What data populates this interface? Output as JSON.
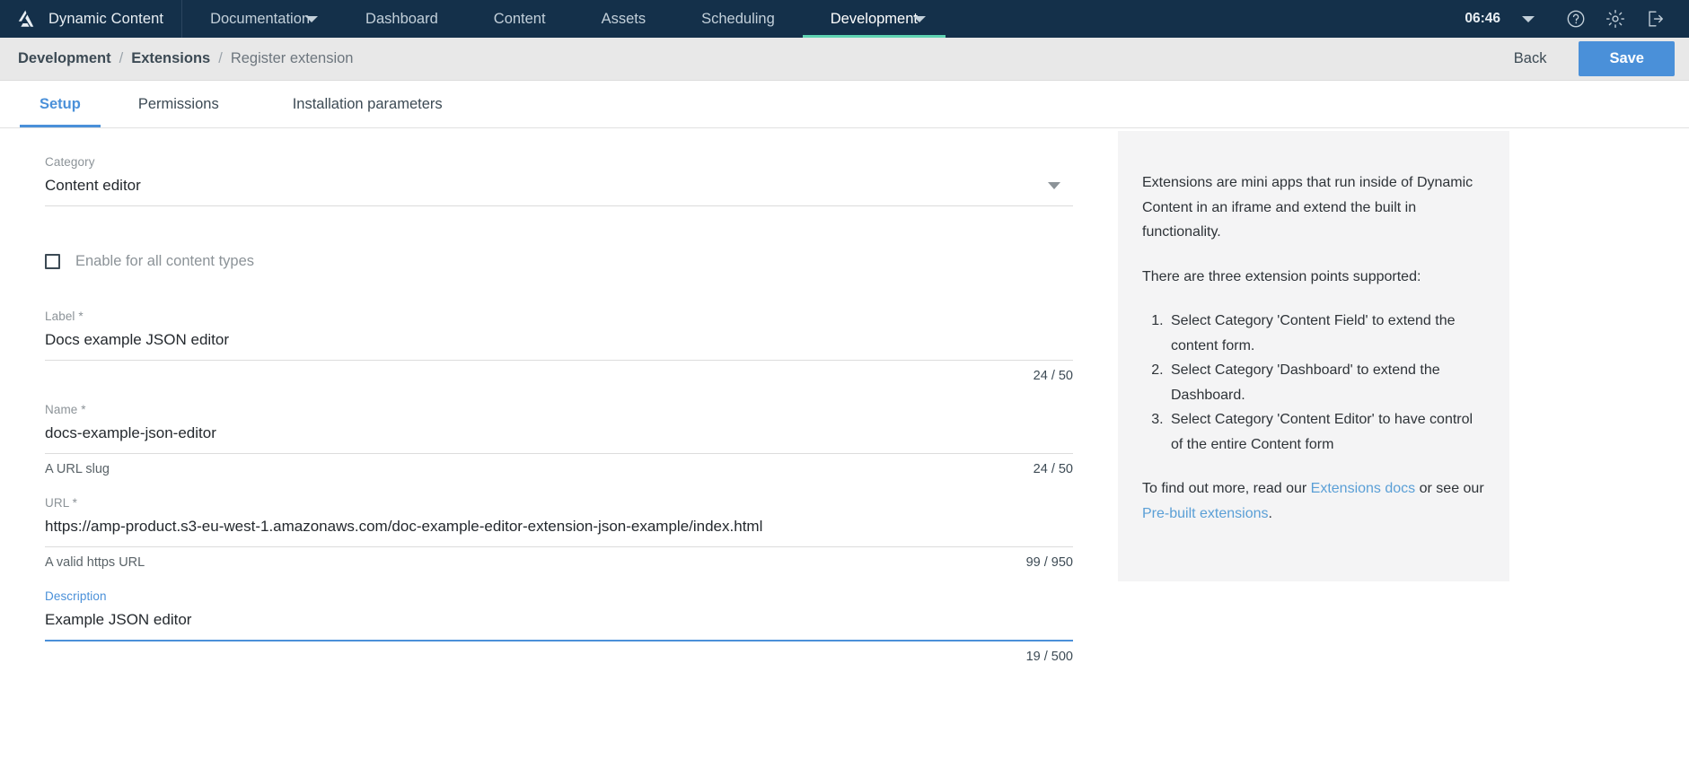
{
  "topbar": {
    "brand": "Dynamic Content",
    "logo_icon": "amplience-logo-icon",
    "nav": [
      {
        "label": "Documentation",
        "caret": true,
        "active": false
      },
      {
        "label": "Dashboard",
        "caret": false,
        "active": false
      },
      {
        "label": "Content",
        "caret": false,
        "active": false
      },
      {
        "label": "Assets",
        "caret": false,
        "active": false
      },
      {
        "label": "Scheduling",
        "caret": false,
        "active": false
      },
      {
        "label": "Development",
        "caret": true,
        "active": true
      }
    ],
    "clock": "06:46",
    "help_icon": "question-circle-icon",
    "settings_icon": "gear-icon",
    "logout_icon": "sign-out-icon",
    "accent_color": "#5fd3b2",
    "bg_color": "#14304a"
  },
  "breadcrumb": {
    "items": [
      "Development",
      "Extensions",
      "Register extension"
    ],
    "separator": "/",
    "back_label": "Back",
    "save_label": "Save",
    "save_color": "#4a90d9"
  },
  "tabs": [
    {
      "label": "Setup",
      "active": true
    },
    {
      "label": "Permissions",
      "active": false
    },
    {
      "label": "Installation parameters",
      "active": false
    }
  ],
  "form": {
    "category": {
      "label": "Category",
      "value": "Content editor",
      "caret_icon": "chevron-down-icon"
    },
    "enable_all": {
      "label": "Enable for all content types",
      "checked": false
    },
    "label_field": {
      "label": "Label *",
      "value": "Docs example JSON editor",
      "helper": "",
      "counter": "24 / 50"
    },
    "name_field": {
      "label": "Name *",
      "value": "docs-example-json-editor",
      "helper": "A URL slug",
      "counter": "24 / 50"
    },
    "url_field": {
      "label": "URL *",
      "value": "https://amp-product.s3-eu-west-1.amazonaws.com/doc-example-editor-extension-json-example/index.html",
      "helper": "A valid https URL",
      "counter": "99 / 950"
    },
    "description_field": {
      "label": "Description",
      "value": "Example JSON editor",
      "helper": "",
      "counter": "19 / 500",
      "focused": true
    }
  },
  "info_panel": {
    "paragraph_1": "Extensions are mini apps that run inside of Dynamic Content in an iframe and extend the built in functionality.",
    "paragraph_2": "There are three extension points supported:",
    "list": [
      "Select Category 'Content Field' to extend the content form.",
      "Select Category 'Dashboard' to extend the Dashboard.",
      "Select Category 'Content Editor' to have control of the entire Content form"
    ],
    "footer_prefix": "To find out more, read our ",
    "link_1": "Extensions docs",
    "footer_middle": " or see our ",
    "link_2": "Pre-built extensions",
    "footer_suffix": ".",
    "link_color": "#5a9fd6"
  }
}
